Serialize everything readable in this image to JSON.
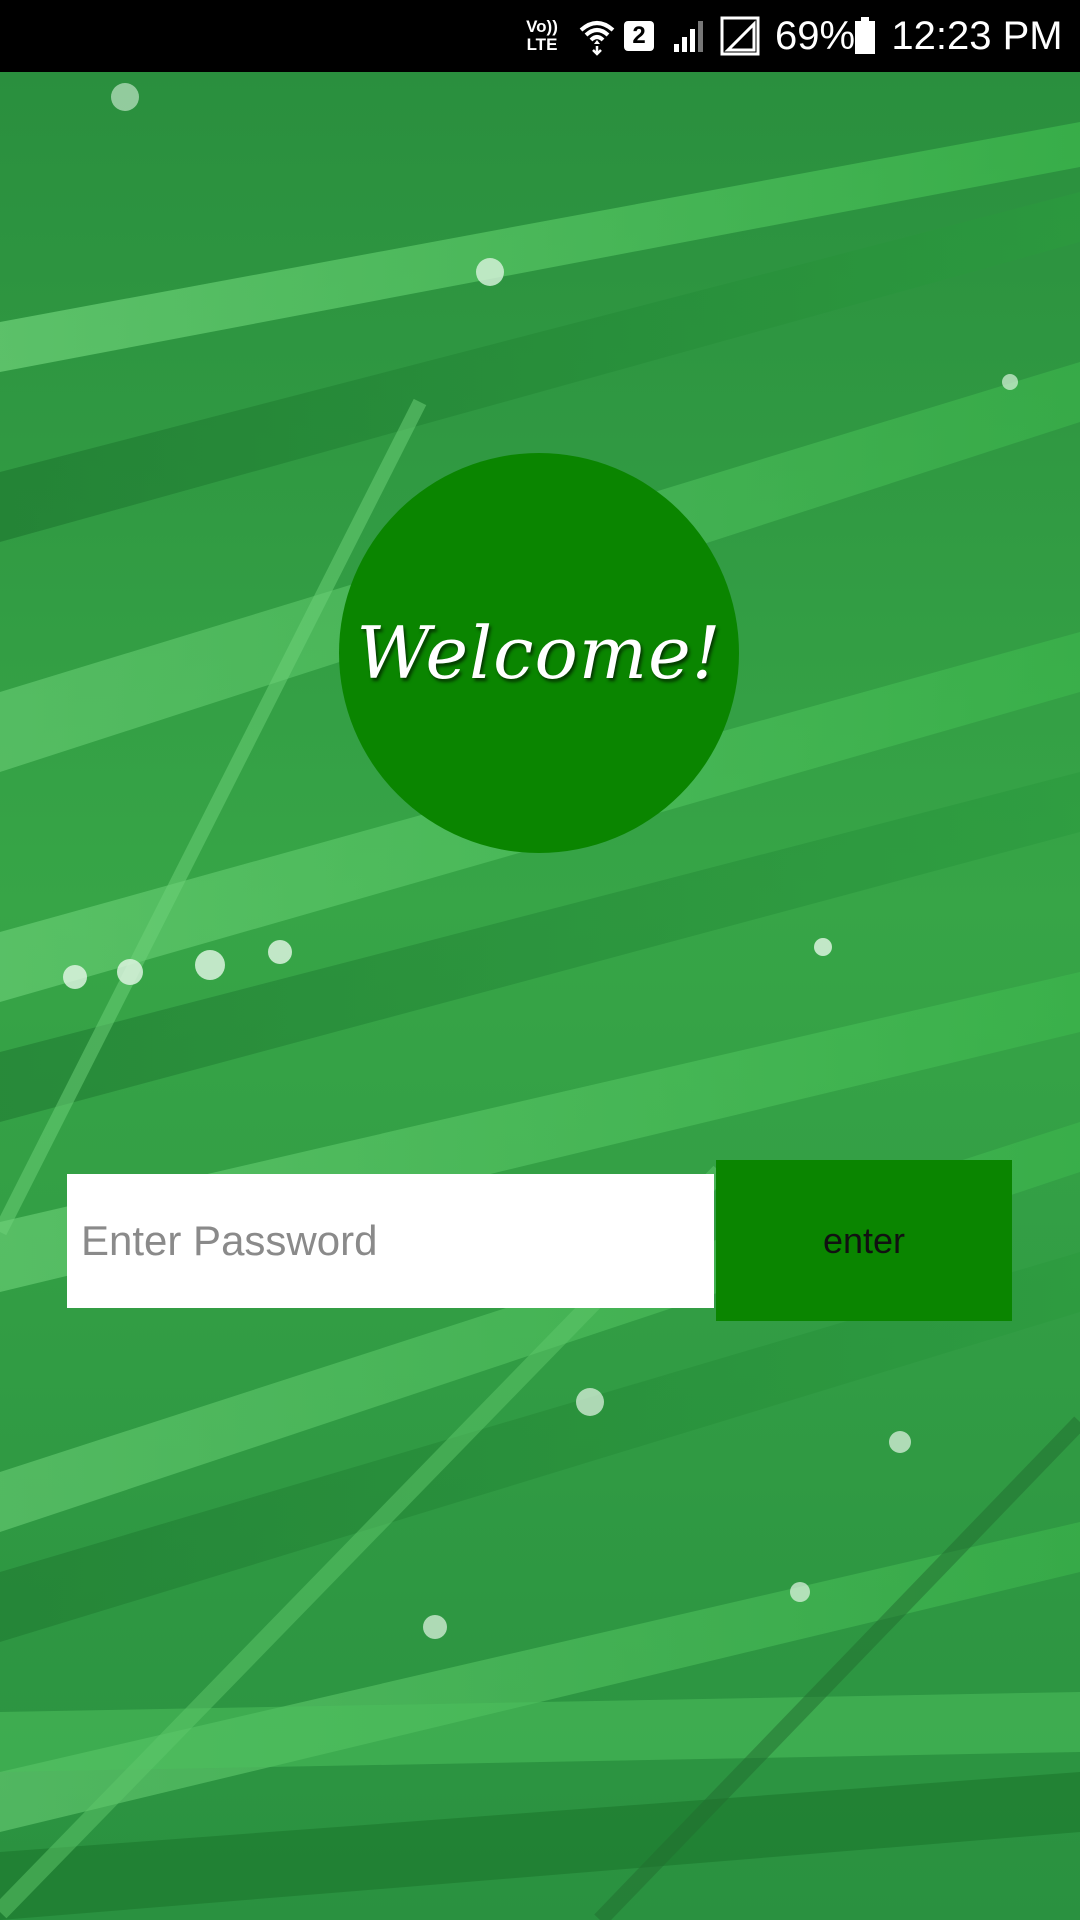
{
  "status_bar": {
    "volte_top": "Vo))",
    "volte_bottom": "LTE",
    "sim_slot": "2",
    "battery": "69%",
    "time": "12:23 PM",
    "icons": [
      "volte-icon",
      "wifi-icon",
      "sim-2-icon",
      "signal-icon",
      "signal-empty-icon",
      "battery-icon"
    ]
  },
  "welcome": {
    "text": "Welcome!",
    "circle_color": "#0a8500"
  },
  "login": {
    "password_placeholder": "Enter Password",
    "password_value": "",
    "enter_label": "enter",
    "button_color": "#0a8500"
  },
  "background": {
    "description_icon": "grass-background"
  }
}
